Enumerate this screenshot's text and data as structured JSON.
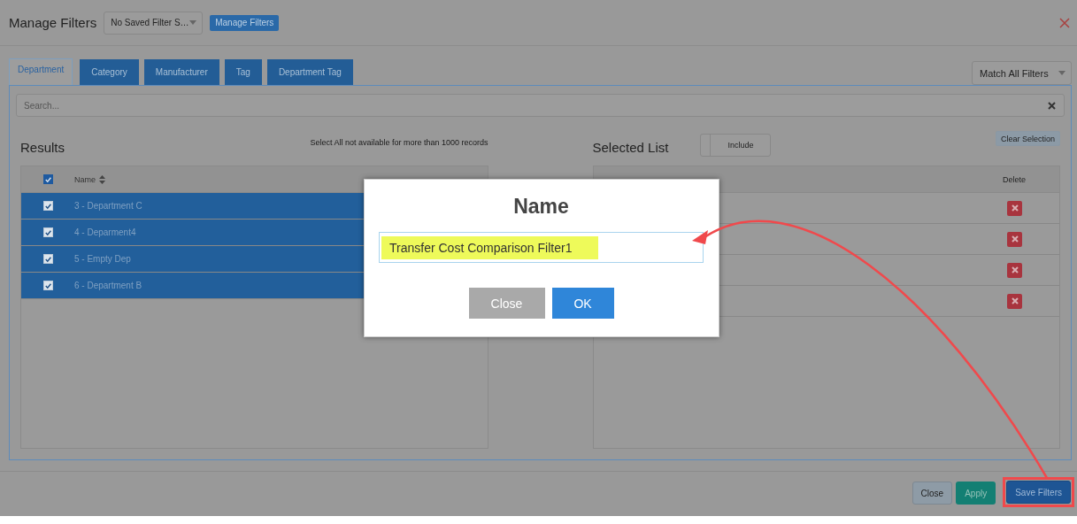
{
  "header": {
    "title": "Manage Filters",
    "saved_filter_select": {
      "value": "No Saved Filter S…"
    },
    "manage_button": "Manage Filters"
  },
  "tabs": [
    {
      "label": "Department",
      "selected": true
    },
    {
      "label": "Category",
      "selected": false
    },
    {
      "label": "Manufacturer",
      "selected": false
    },
    {
      "label": "Tag",
      "selected": false
    },
    {
      "label": "Department Tag",
      "selected": false
    }
  ],
  "match_select": {
    "value": "Match All Filters"
  },
  "search": {
    "placeholder": "Search..."
  },
  "results": {
    "title": "Results",
    "note": "Select All not available for more than 1000 records",
    "header_checked": true,
    "column": "Name",
    "rows": [
      {
        "label": "3 - Department C",
        "checked": true,
        "selected": true
      },
      {
        "label": "4 - Deparment4",
        "checked": true,
        "selected": true
      },
      {
        "label": "5 - Empty Dep",
        "checked": true,
        "selected": true
      },
      {
        "label": "6 - Department B",
        "checked": true,
        "selected": true
      }
    ]
  },
  "selected_list": {
    "title": "Selected List",
    "toggle_label": "Include",
    "clear_button": "Clear Selection",
    "delete_column": "Delete",
    "rows": [
      {
        "deletable": true
      },
      {
        "deletable": true
      },
      {
        "deletable": true
      },
      {
        "deletable": true
      }
    ]
  },
  "footer_buttons": [
    {
      "label": "Close",
      "kind": "default",
      "highlighted": false
    },
    {
      "label": "Apply",
      "kind": "success",
      "highlighted": false
    },
    {
      "label": "Save Filters",
      "kind": "primary",
      "highlighted": true
    }
  ],
  "dialog": {
    "title": "Name",
    "value": "Transfer Cost Comparison Filter1",
    "value_highlighted": true,
    "buttons": [
      {
        "label": "Close",
        "kind": "secondary"
      },
      {
        "label": "OK",
        "kind": "primary"
      }
    ]
  },
  "annotations": [
    {
      "kind": "arrow"
    }
  ]
}
